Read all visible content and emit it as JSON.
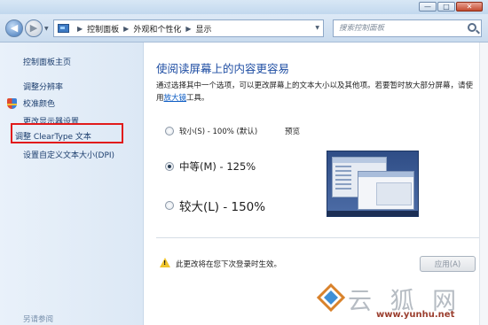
{
  "window": {
    "minimize_glyph": "—",
    "maximize_glyph": "□",
    "close_glyph": "✕"
  },
  "address": {
    "back_glyph": "◀",
    "forward_glyph": "▶",
    "dropdown_glyph": "▼",
    "separator_glyph": "▶",
    "crumbs": [
      "控制面板",
      "外观和个性化",
      "显示"
    ],
    "refresh_glyph": "↻"
  },
  "search": {
    "placeholder": "搜索控制面板"
  },
  "sidebar": {
    "home": "控制面板主页",
    "items": [
      "调整分辨率",
      "校准颜色",
      "更改显示器设置",
      "调整 ClearType 文本",
      "设置自定义文本大小(DPI)"
    ],
    "see_also": "另请参阅"
  },
  "main": {
    "title": "使阅读屏幕上的内容更容易",
    "desc_part1": "通过选择其中一个选项，可以更改屏幕上的文本大小以及其他项。若要暂时放大部分屏幕，请使用",
    "desc_link": "放大镜",
    "desc_part2": "工具。",
    "preview_label": "预览",
    "options": [
      {
        "label": "较小(S) - 100% (默认)",
        "selected": false
      },
      {
        "label": "中等(M) - 125%",
        "selected": true
      },
      {
        "label": "较大(L) - 150%",
        "selected": false
      }
    ],
    "warning": "此更改将在您下次登录时生效。",
    "apply_label": "应用(A)"
  },
  "watermark": {
    "text": "云 狐 网",
    "url": "www.yunhu.net"
  }
}
